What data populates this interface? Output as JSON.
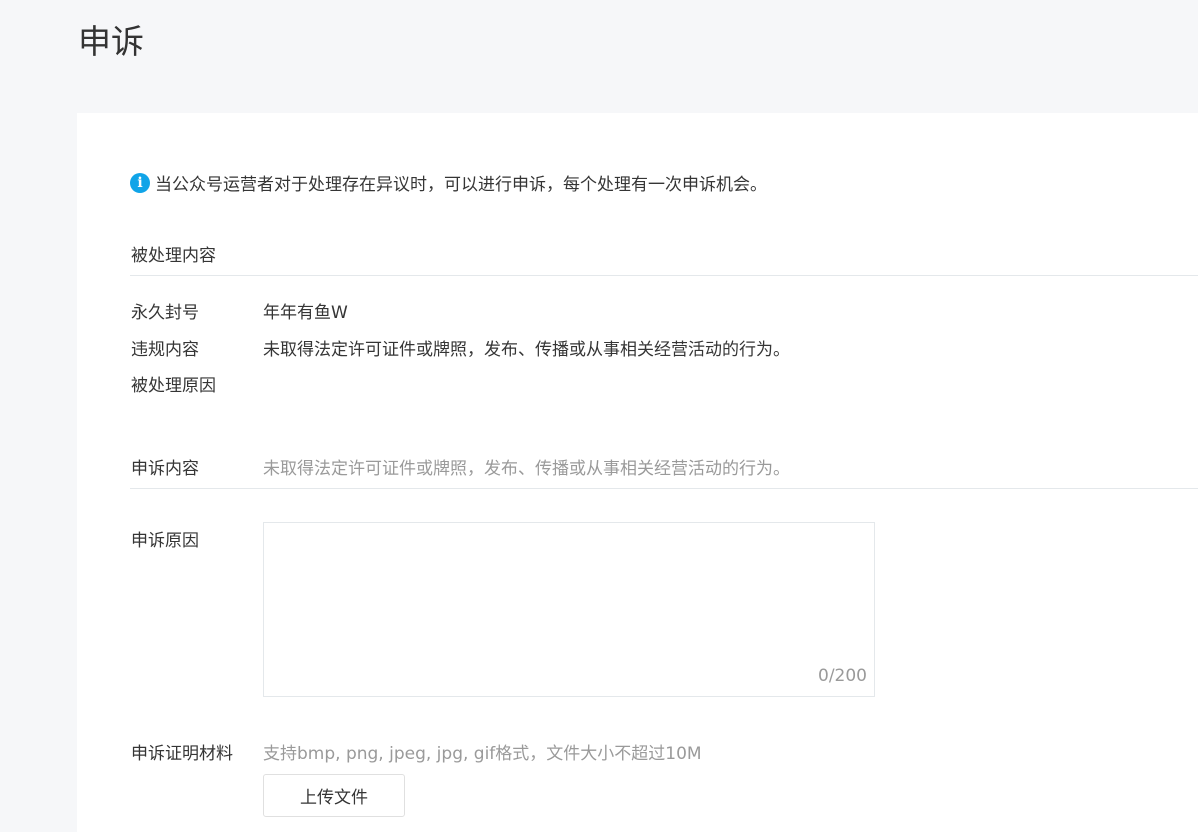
{
  "page": {
    "title": "申诉"
  },
  "notice": {
    "icon": "info-icon",
    "icon_glyph": "i",
    "text": "当公众号运营者对于处理存在异议时，可以进行申诉，每个处理有一次申诉机会。"
  },
  "handled_section": {
    "title": "被处理内容",
    "rows": [
      {
        "label": "永久封号",
        "value": "年年有鱼W"
      },
      {
        "label": "违规内容",
        "value": "未取得法定许可证件或牌照，发布、传播或从事相关经营活动的行为。"
      },
      {
        "label": "被处理原因",
        "value": ""
      }
    ]
  },
  "appeal": {
    "content_label": "申诉内容",
    "content_value": "未取得法定许可证件或牌照，发布、传播或从事相关经营活动的行为。",
    "reason_label": "申诉原因",
    "reason_value": "",
    "reason_counter": "0/200",
    "evidence_label": "申诉证明材料",
    "evidence_hint": "支持bmp, png, jpeg, jpg, gif格式，文件大小不超过10M",
    "upload_button": "上传文件"
  },
  "colors": {
    "background": "#f6f7f9",
    "card": "#ffffff",
    "info_accent": "#10a4e8",
    "muted_text": "#9a9a9a",
    "divider": "#e4e8eb"
  }
}
